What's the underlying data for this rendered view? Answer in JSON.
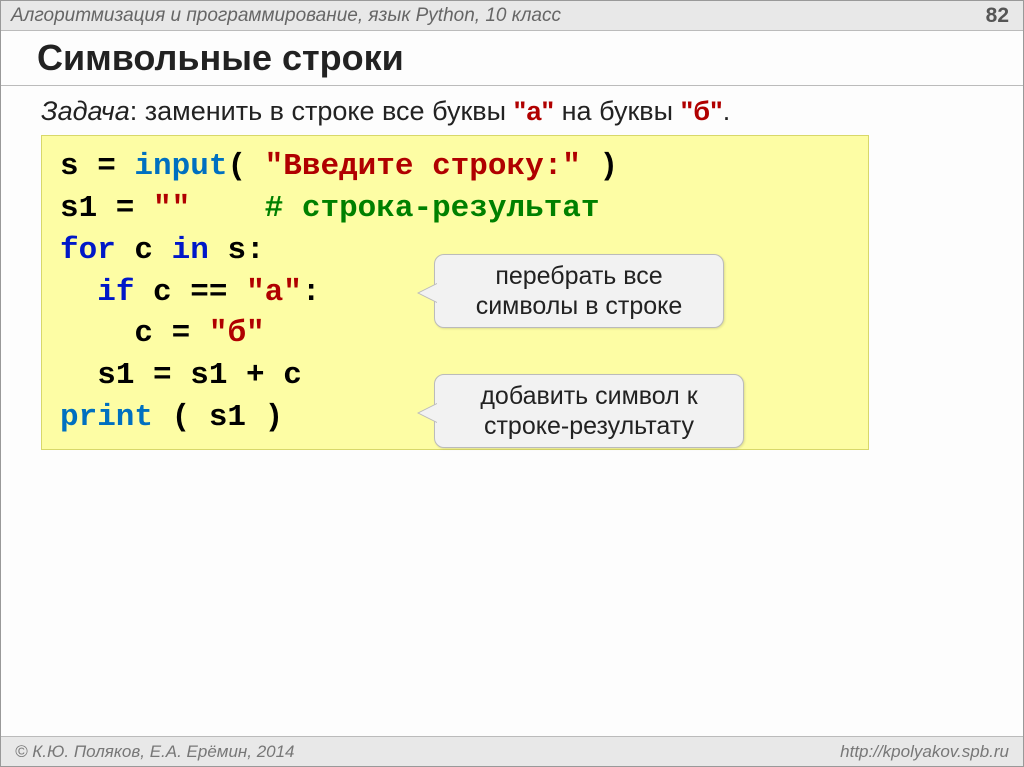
{
  "header": {
    "course": "Алгоритмизация и программирование, язык Python, 10 класс",
    "page": "82"
  },
  "title": "Символьные строки",
  "task": {
    "label": "Задача",
    "sep": ": ",
    "text_before_a": "заменить в строке все буквы ",
    "a": "\"а\"",
    "text_mid": " на буквы ",
    "b": "\"б\"",
    "tail": "."
  },
  "code": {
    "l1_a": "s = ",
    "l1_fn": "input",
    "l1_b": "( ",
    "l1_str": "\"Введите строку:\"",
    "l1_c": " )",
    "l2_a": "s1 = ",
    "l2_str": "\"\"",
    "l2_sp": "    ",
    "l2_cmt": "# строка-результат",
    "l3_a": "for",
    "l3_b": " c ",
    "l3_c": "in",
    "l3_d": " s:",
    "l4_pad": "  ",
    "l4_a": "if",
    "l4_b": " c == ",
    "l4_str": "\"а\"",
    "l4_c": ":",
    "l5_pad": "    ",
    "l5_a": "c = ",
    "l5_str": "\"б\"",
    "l6_pad": "  ",
    "l6_a": "s1 = s1 + c",
    "l7_fn": "print",
    "l7_a": " ( s1 )"
  },
  "callouts": {
    "c1_line1": "перебрать все",
    "c1_line2": "символы в строке",
    "c2_line1": "добавить символ к",
    "c2_line2": "строке-результату"
  },
  "footer": {
    "left": "© К.Ю. Поляков, Е.А. Ерёмин, 2014",
    "right": "http://kpolyakov.spb.ru"
  }
}
